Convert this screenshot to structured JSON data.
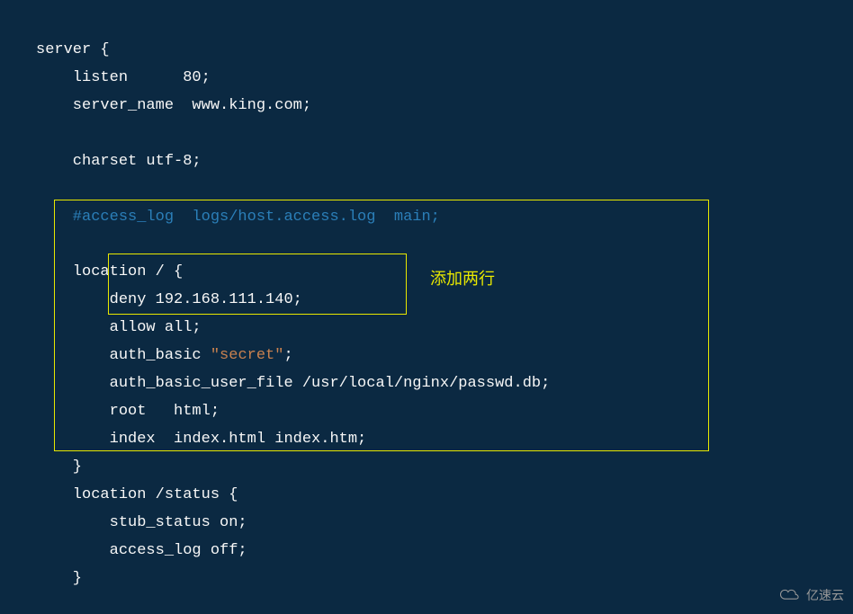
{
  "code": {
    "line1_part1": "server {",
    "line2_indent": "    listen      80;",
    "line3_indent": "    server_name  www.king.com;",
    "line4_blank": "",
    "line5_charset": "    charset utf-8;",
    "line6_blank": "",
    "line7_comment": "    #access_log  logs/host.access.log  main;",
    "line8_blank": "",
    "line9_location": "    location / {",
    "line10_deny": "        deny 192.168.111.140;",
    "line11_allow": "        allow all;",
    "line12_auth_pre": "        auth_basic ",
    "line12_auth_string": "\"secret\"",
    "line12_auth_post": ";",
    "line13_authfile": "        auth_basic_user_file /usr/local/nginx/passwd.db;",
    "line14_root": "        root   html;",
    "line15_index": "        index  index.html index.htm;",
    "line16_close": "    }",
    "line17_status": "    location /status {",
    "line18_stub": "        stub_status on;",
    "line19_access": "        access_log off;",
    "line20_close": "    }"
  },
  "annotation": {
    "text": "添加两行"
  },
  "watermark": {
    "text": "亿速云"
  }
}
